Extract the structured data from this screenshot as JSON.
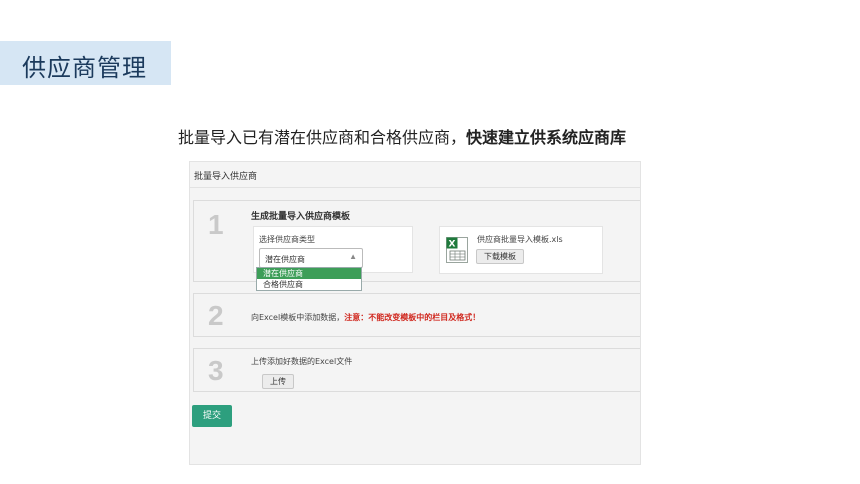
{
  "slide": {
    "title": "供应商管理",
    "headline_normal": "批量导入已有潜在供应商和合格供应商，",
    "headline_bold": "快速建立供系统应商库"
  },
  "panel": {
    "title": "批量导入供应商",
    "steps": [
      {
        "number": "1",
        "title": "生成批量导入供应商模板",
        "type_label": "选择供应商类型",
        "select_value": "潜在供应商",
        "options": [
          "潜在供应商",
          "合格供应商"
        ],
        "template_filename": "供应商批量导入模板.xls",
        "download_label": "下载模板"
      },
      {
        "number": "2",
        "text": "向Excel模板中添加数据，",
        "warning": "注意：不能改变模板中的栏目及格式！"
      },
      {
        "number": "3",
        "text": "上传添加好数据的Excel文件",
        "upload_label": "上传"
      }
    ],
    "submit_label": "提交"
  },
  "colors": {
    "title_band": "#d6e6f4",
    "submit": "#2d9f7e",
    "dropdown_highlight": "#3d9e58",
    "warning": "#d0281f",
    "excel_icon": "#1f7a3c"
  }
}
